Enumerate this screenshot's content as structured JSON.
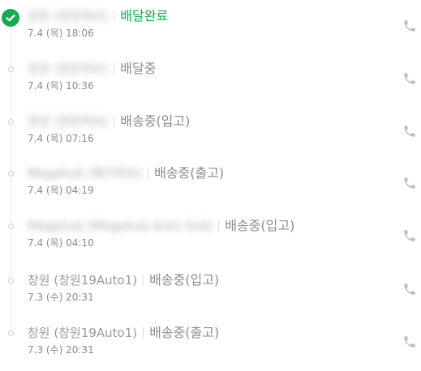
{
  "colors": {
    "active_status": "#18a84f",
    "muted_text": "#9a9a9a",
    "timeline": "#ececec",
    "phone_icon": "#b9c0cc"
  },
  "entries": [
    {
      "origin": "천안 (천안허브)",
      "origin_blurred": true,
      "status": "배달완료",
      "status_active": true,
      "time": "7.4 (목) 18:06",
      "icon": "phone-icon"
    },
    {
      "origin": "천안 (천안허브)",
      "origin_blurred": true,
      "status": "배달중",
      "status_active": false,
      "time": "7.4 (목) 10:36",
      "icon": "phone-icon"
    },
    {
      "origin": "천안 (천안허브)",
      "origin_blurred": true,
      "status": "배송중(입고)",
      "status_active": false,
      "time": "7.4 (목) 07:16",
      "icon": "phone-icon"
    },
    {
      "origin": "Megahub (메가허브)",
      "origin_blurred": true,
      "status": "배송중(출고)",
      "status_active": false,
      "time": "7.4 (목) 04:19",
      "icon": "phone-icon"
    },
    {
      "origin": "Megahub (Megahub Auto Sub)",
      "origin_blurred": true,
      "status": "배송중(입고)",
      "status_active": false,
      "time": "7.4 (목) 04:10",
      "icon": "phone-icon"
    },
    {
      "origin": "창원 (창원19Auto1)",
      "origin_blurred": false,
      "status": "배송중(입고)",
      "status_active": false,
      "time": "7.3 (수) 20:31",
      "icon": "phone-icon"
    },
    {
      "origin": "창원 (창원19Auto1)",
      "origin_blurred": false,
      "status": "배송중(출고)",
      "status_active": false,
      "time": "7.3 (수) 20:31",
      "icon": "phone-icon"
    }
  ]
}
